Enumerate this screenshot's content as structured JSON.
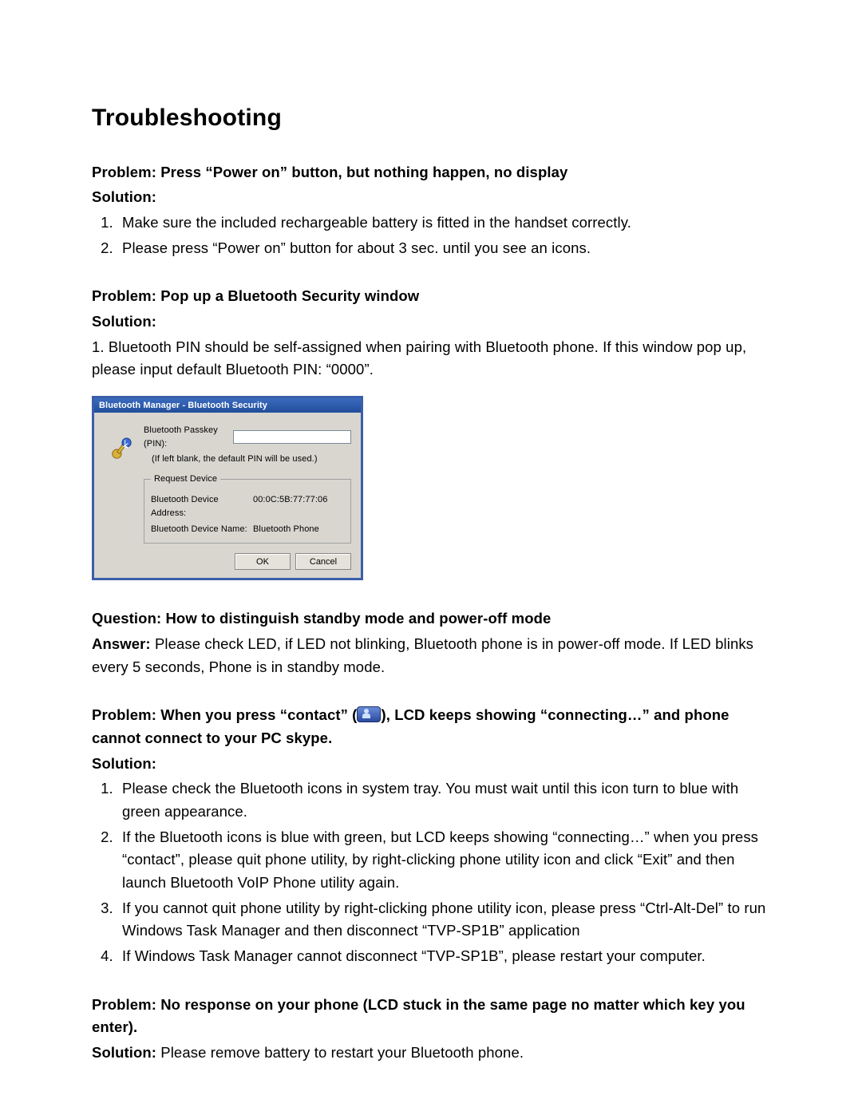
{
  "title": "Troubleshooting",
  "s1": {
    "problem_label": "Problem:",
    "problem_text": " Press “Power on” button, but nothing happen, no display",
    "solution_label": "Solution:",
    "items": [
      "Make sure the included rechargeable battery is fitted in the handset correctly.",
      "Please press “Power on” button for about 3 sec. until you see an icons."
    ]
  },
  "s2": {
    "problem_label": "Problem:",
    "problem_text": " Pop up a Bluetooth Security window",
    "solution_label": "Solution:",
    "body": "1. Bluetooth PIN should be self-assigned when pairing with Bluetooth phone. If this window pop up, please input default Bluetooth PIN: “0000”."
  },
  "dialog": {
    "title": "Bluetooth Manager - Bluetooth Security",
    "pin_label": "Bluetooth Passkey (PIN):",
    "pin_placeholder": "",
    "hint": "(If left blank, the default PIN will be used.)",
    "group_label": "Request Device",
    "addr_label": "Bluetooth Device Address:",
    "addr_value": "00:0C:5B:77:77:06",
    "name_label": "Bluetooth Device Name:",
    "name_value": "Bluetooth Phone",
    "ok": "OK",
    "cancel": "Cancel"
  },
  "s3": {
    "question_label": "Question:",
    "question_text": " How to distinguish standby mode and power-off mode",
    "answer_label": "Answer:",
    "answer_text": " Please check LED, if LED not blinking, Bluetooth phone is in power-off mode. If LED blinks every 5 seconds, Phone is in standby mode."
  },
  "s4": {
    "problem_label": "Problem:",
    "pre_icon": " When you press “contact” (",
    "post_icon": "), LCD keeps showing “connecting…” and phone cannot connect to your PC skype.",
    "solution_label": "Solution:",
    "items": [
      "Please check the Bluetooth icons in system tray. You must wait until this icon turn to blue with green appearance.",
      "If the Bluetooth icons is blue with green, but LCD keeps showing “connecting…” when you press “contact”, please quit phone utility, by right-clicking phone utility icon and click “Exit” and then launch Bluetooth VoIP Phone utility again.",
      "If you cannot quit phone utility by right-clicking phone utility icon, please press “Ctrl-Alt-Del” to run Windows Task Manager and then disconnect “TVP-SP1B” application",
      "If Windows Task Manager cannot disconnect “TVP-SP1B”, please restart your computer."
    ]
  },
  "s5": {
    "problem_label": "Problem:",
    "problem_text": " No response on your phone (LCD stuck in the same page no matter which key you enter).",
    "solution_label": "Solution:",
    "solution_text": " Please remove battery to restart your Bluetooth phone."
  }
}
